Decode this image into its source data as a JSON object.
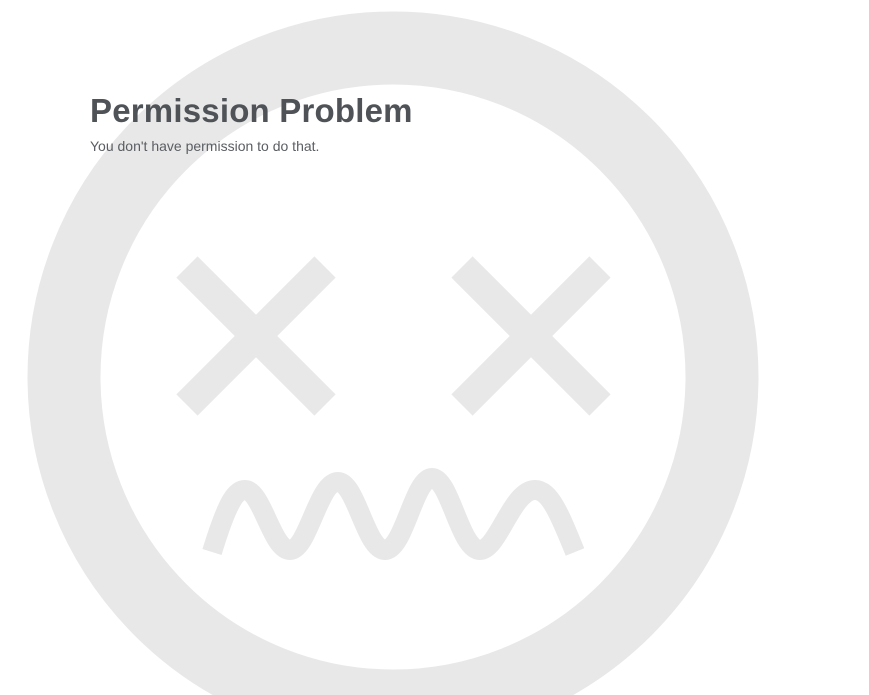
{
  "page": {
    "title": "Permission Problem",
    "message": "You don't have permission to do that."
  },
  "illustration": {
    "icon": "dead-face-icon",
    "color": "#e8e8e8"
  }
}
